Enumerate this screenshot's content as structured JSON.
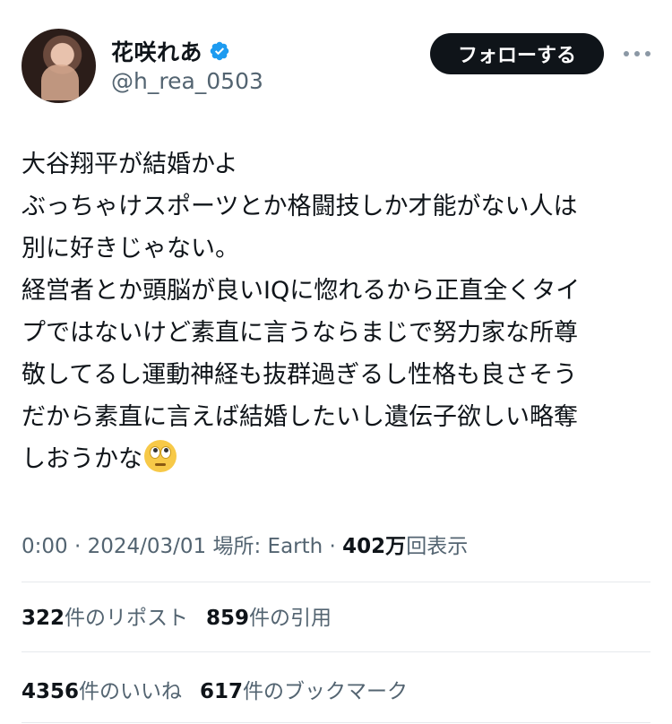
{
  "user": {
    "name": "花咲れあ",
    "handle": "@h_rea_0503",
    "follow_label": "フォローする",
    "verified_color": "#1d9bf0"
  },
  "tweet": {
    "lines": [
      "大谷翔平が結婚かよ",
      "ぶっちゃけスポーツとか格闘技しか才能がない人は",
      "別に好きじゃない。",
      "経営者とか頭脳が良いIQに惚れるから正直全くタイ",
      "プではないけど素直に言うならまじで努力家な所尊",
      "敬してるし運動神経も抜群過ぎるし性格も良さそう",
      "だから素直に言えば結婚したいし遺伝子欲しい略奪",
      "しおうかな"
    ],
    "emoji": "face-with-rolling-eyes"
  },
  "meta": {
    "time": "0:00",
    "date": "2024/03/01",
    "location_label": "場所: Earth",
    "views_count": "402万",
    "views_label": "回表示"
  },
  "stats": {
    "reposts_count": "322",
    "reposts_label": "件のリポスト",
    "quotes_count": "859",
    "quotes_label": "件の引用",
    "likes_count": "4356",
    "likes_label": "件のいいね",
    "bookmarks_count": "617",
    "bookmarks_label": "件のブックマーク"
  }
}
